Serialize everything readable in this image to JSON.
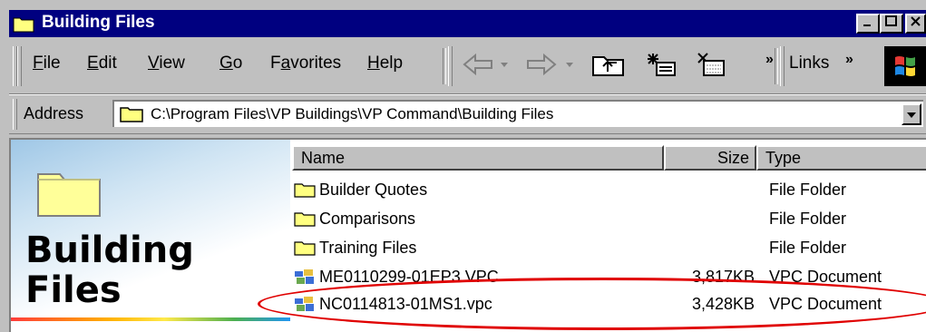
{
  "window": {
    "title": "Building Files",
    "buttons": [
      "_",
      "☐",
      "X"
    ]
  },
  "menu": [
    {
      "label": "File",
      "key": "F"
    },
    {
      "label": "Edit",
      "key": "E"
    },
    {
      "label": "View",
      "key": "V"
    },
    {
      "label": "Go",
      "key": "G"
    },
    {
      "label": "Favorites",
      "key": "a"
    },
    {
      "label": "Help",
      "key": "H"
    }
  ],
  "menu_labels": {
    "file": "File",
    "edit": "Edit",
    "view": "View",
    "go": "Go",
    "favorites": "Favorites",
    "help": "Help"
  },
  "toolbar": {
    "chevron": "»",
    "links_label": "Links",
    "links_chevron": "»"
  },
  "address": {
    "label": "Address",
    "value": "C:\\Program Files\\VP Buildings\\VP Command\\Building Files"
  },
  "left_pane": {
    "title_line1": "Building",
    "title_line2": "Files"
  },
  "columns": {
    "name": "Name",
    "size": "Size",
    "type": "Type"
  },
  "files": [
    {
      "name": "Builder Quotes",
      "size": "",
      "type": "File Folder",
      "icon": "folder-icon"
    },
    {
      "name": "Comparisons",
      "size": "",
      "type": "File Folder",
      "icon": "folder-icon"
    },
    {
      "name": "Training Files",
      "size": "",
      "type": "File Folder",
      "icon": "folder-icon"
    },
    {
      "name": "ME0110299-01EP3.VPC",
      "size": "3,817KB",
      "type": "VPC Document",
      "icon": "vpc-document-icon"
    },
    {
      "name": "NC0114813-01MS1.vpc",
      "size": "3,428KB",
      "type": "VPC Document",
      "icon": "vpc-document-icon"
    }
  ],
  "highlight": {
    "color": "#e00000"
  }
}
